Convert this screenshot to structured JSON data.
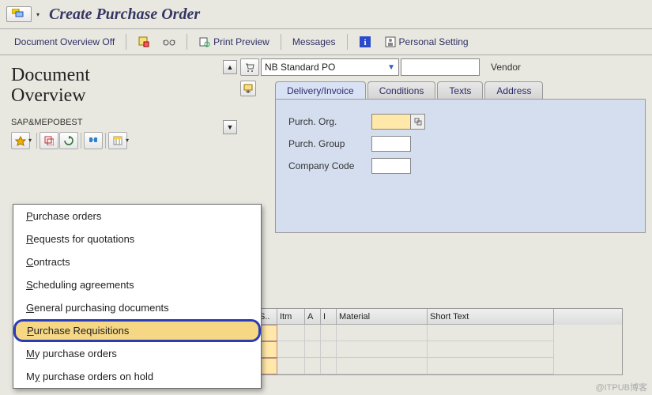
{
  "window": {
    "title": "Create Purchase Order"
  },
  "toolbar": {
    "doc_overview_toggle": "Document Overview Off",
    "print_preview": "Print Preview",
    "messages": "Messages",
    "personal_setting": "Personal Setting"
  },
  "doc_overview": {
    "title_line1": "Document",
    "title_line2": "Overview",
    "variant_label": "SAP&MEPOBEST"
  },
  "menu": {
    "items": [
      {
        "text": "Purchase orders",
        "accel_pos": 0
      },
      {
        "text": "Requests for quotations",
        "accel_pos": 0
      },
      {
        "text": "Contracts",
        "accel_pos": 0
      },
      {
        "text": "Scheduling agreements",
        "accel_pos": 0
      },
      {
        "text": "General purchasing documents",
        "accel_pos": 0
      },
      {
        "text": "Purchase Requisitions",
        "accel_pos": 0,
        "highlight": true
      },
      {
        "text": "My purchase orders",
        "accel_pos": 0
      },
      {
        "text": "My purchase orders on hold",
        "accel_pos": 1
      }
    ]
  },
  "header": {
    "doc_type": "NB Standard PO",
    "po_number": "",
    "vendor_label": "Vendor",
    "tabs": {
      "delivery_invoice": "Delivery/Invoice",
      "conditions": "Conditions",
      "texts": "Texts",
      "address": "Address"
    },
    "fields": {
      "purch_org_label": "Purch. Org.",
      "purch_group_label": "Purch. Group",
      "company_code_label": "Company Code",
      "purch_org_value": "",
      "purch_group_value": "",
      "company_code_value": ""
    }
  },
  "grid": {
    "headers": {
      "status": "S..",
      "itm": "Itm",
      "a": "A",
      "i": "I",
      "material": "Material",
      "short_text": "Short Text"
    }
  },
  "watermark": "@ITPUB博客"
}
